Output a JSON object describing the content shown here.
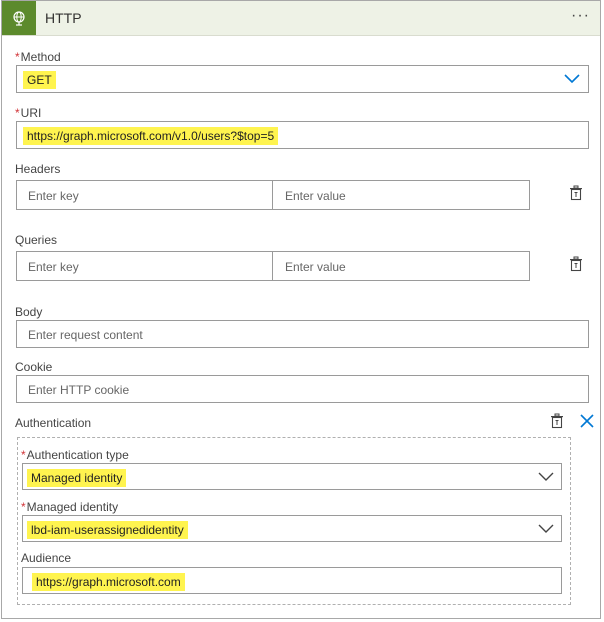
{
  "header": {
    "title": "HTTP",
    "menu_label": "···",
    "icon": "globe-icon"
  },
  "method": {
    "label": "Method",
    "value": "GET"
  },
  "uri": {
    "label": "URI",
    "value": "https://graph.microsoft.com/v1.0/users?$top=5"
  },
  "headers": {
    "label": "Headers",
    "key_placeholder": "Enter key",
    "value_placeholder": "Enter value"
  },
  "queries": {
    "label": "Queries",
    "key_placeholder": "Enter key",
    "value_placeholder": "Enter value"
  },
  "body": {
    "label": "Body",
    "placeholder": "Enter request content"
  },
  "cookie": {
    "label": "Cookie",
    "placeholder": "Enter HTTP cookie"
  },
  "authentication": {
    "label": "Authentication",
    "type": {
      "label": "Authentication type",
      "value": "Managed identity"
    },
    "identity": {
      "label": "Managed identity",
      "value": "lbd-iam-userassignedidentity"
    },
    "audience": {
      "label": "Audience",
      "value": "https://graph.microsoft.com"
    }
  },
  "required_mark": "*",
  "colors": {
    "accent": "#5c8a2c",
    "highlight": "#fff44f",
    "chevron": "#0078d4",
    "required": "#d13438"
  }
}
